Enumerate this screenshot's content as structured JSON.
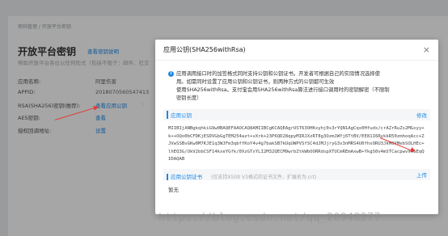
{
  "background": {
    "breadcrumb": "密码管理 / 开放平台密钥",
    "title": "开放平台密钥",
    "title_link": "查看密钥说明",
    "description": "帮助开放平台各位以任何形式（包括不限于：邮件、社交",
    "rows": [
      {
        "label": "应用名称:",
        "value": "阿里伤害"
      },
      {
        "label": "APPID:",
        "value": "2018070560547413"
      },
      {
        "label": "RSA(SHA256)密钥(推荐):",
        "value": "查看应用公钥"
      },
      {
        "label": "AES密钥:",
        "value": "查看"
      },
      {
        "label": "授权回调地址:",
        "value": "设置"
      }
    ],
    "sep": "|"
  },
  "modal": {
    "title": "应用公钥(SHA256withRsa)",
    "close_icon": "×",
    "info_lines": [
      "应用调用接口时的加签格式同时支持公钥和公钥证书。开发者可根据自己的实际情况选择使",
      "用。如需同时设置了应用公钥和公钥证书，则两种方式的公钥都可生效",
      "使用SHA256withRsa。支付宝会用SHA256withRsa算法进行接口调用时的密钥解密（不限制",
      "密钥长度）"
    ],
    "public_key_section": {
      "label": "应用公钥",
      "action": "修改"
    },
    "public_key_text": "MIIBIjANBgkqhkiG9w0BAQEFAAOCAQ8AMIIBCgKCAQEAgrUST63OHKxyhj0s3rYQN1AgCqx0Hfuds/crAZrRuZs2MGxyy+k++OQo0bCFDKjESDVGbGgTEM254azt+vXrk+23P6QD28qpyMIRJXzRT8g3OzmJWYj6TtBV/EE81I6RykkR50zmhoqAcc+ZJVwSSBvGKw0M7KJE1q3WJFm3qbffKoY4v4g7bakSB7kUqUWPVSfSC4dJMJjryG3v3nMRS4U0fhxORU3JkM0XMebSOLHEc+lhEQ3G/UkV2bbCSF14kxeYGfk/0XzGTxYLI2M32QECM9wrbZtkWbOORRdspXTUCmREmAxwB+YkgS0v4mSTCacpwvVAGEqQIDAQAB",
    "cert_section": {
      "label": "应用公钥证书",
      "hint": "(仅支持X509 V3格式的证书文件，扩展名为.crt)",
      "action": "上传"
    },
    "cert_value": "暂无"
  },
  "watermark": "https://blog.csdn.net/qq_20948277",
  "colors": {
    "accent": "#1e88e5",
    "annotation": "#e53935"
  }
}
